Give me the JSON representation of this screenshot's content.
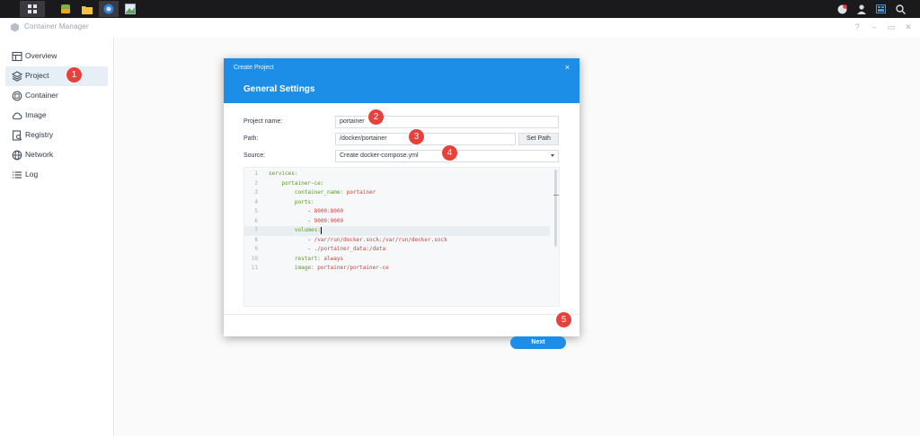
{
  "taskbar": {
    "icons": [
      "grid-icon",
      "app-icon",
      "folder-icon",
      "container-manager-icon",
      "image-icon"
    ],
    "right_icons": [
      "notification-icon",
      "user-icon",
      "widgets-icon",
      "search-icon"
    ]
  },
  "window": {
    "title": "Container Manager",
    "controls": [
      "?",
      "–",
      "▭",
      "✕"
    ]
  },
  "sidebar": {
    "items": [
      {
        "label": "Overview",
        "icon": "overview-icon"
      },
      {
        "label": "Project",
        "icon": "project-icon"
      },
      {
        "label": "Container",
        "icon": "container-icon"
      },
      {
        "label": "Image",
        "icon": "cloud-icon"
      },
      {
        "label": "Registry",
        "icon": "registry-icon"
      },
      {
        "label": "Network",
        "icon": "network-icon"
      },
      {
        "label": "Log",
        "icon": "log-icon"
      }
    ],
    "active": "Project"
  },
  "dialog": {
    "window_title": "Create Project",
    "close": "×",
    "title": "General Settings",
    "project_name_label": "Project name:",
    "project_name_value": "portainer",
    "path_label": "Path:",
    "path_value": "/docker/portainer",
    "set_path_label": "Set Path",
    "source_label": "Source:",
    "source_value": "Create docker-compose.yml",
    "next_label": "Next"
  },
  "editor": {
    "lines": [
      {
        "n": "1",
        "indent": "",
        "key": "services:",
        "val": ""
      },
      {
        "n": "2",
        "indent": "    ",
        "key": "portainer-ce:",
        "val": ""
      },
      {
        "n": "3",
        "indent": "        ",
        "key": "container_name:",
        "val": " portainer"
      },
      {
        "n": "4",
        "indent": "        ",
        "key": "ports:",
        "val": ""
      },
      {
        "n": "5",
        "indent": "            ",
        "key": "- ",
        "val": "8000:8000"
      },
      {
        "n": "6",
        "indent": "            ",
        "key": "- ",
        "val": "9000:9000"
      },
      {
        "n": "7",
        "indent": "        ",
        "key": "volumes:",
        "val": ""
      },
      {
        "n": "8",
        "indent": "            ",
        "key": "- ",
        "val": "/var/run/docker.sock:/var/run/docker.sock"
      },
      {
        "n": "9",
        "indent": "            ",
        "key": "- ",
        "val": "./portainer_data:/data"
      },
      {
        "n": "10",
        "indent": "        ",
        "key": "restart:",
        "val": " always"
      },
      {
        "n": "11",
        "indent": "        ",
        "key": "image:",
        "val": " portainer/portainer-ce"
      }
    ]
  },
  "badges": [
    "1",
    "2",
    "3",
    "4",
    "5"
  ],
  "colors": {
    "accent": "#1d8ee8",
    "badge": "#e8413b",
    "active_nav": "#e6eef6"
  }
}
